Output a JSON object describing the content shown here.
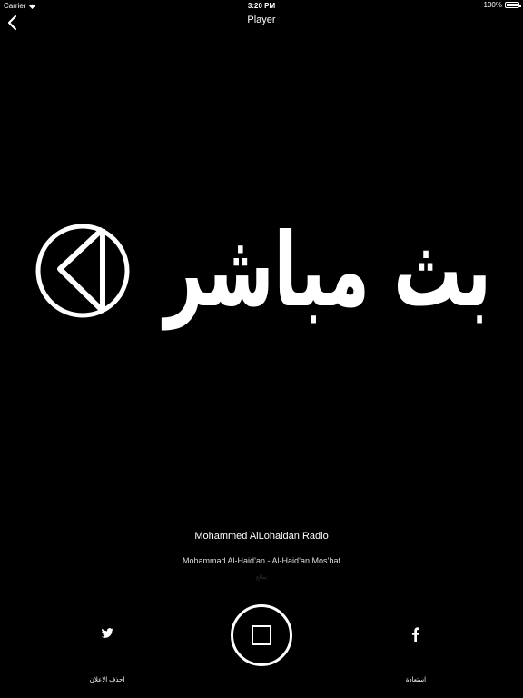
{
  "status_bar": {
    "carrier": "Carrier",
    "time": "3:20 PM",
    "battery": "100%"
  },
  "nav": {
    "title": "Player",
    "back_icon": "chevron-left-icon"
  },
  "artwork": {
    "text": "بث مباشر",
    "icon": "live-play-icon"
  },
  "now_playing": {
    "station": "Mohammed AlLohaidan Radio",
    "track": "Mohammad Al-Haid’an - Al-Haid’an Mos’haf",
    "status": "تمالح"
  },
  "controls": {
    "stop_icon": "stop-icon",
    "twitter_icon": "twitter-icon",
    "facebook_icon": "facebook-icon",
    "remove_ads_label": "احذف الاعلان",
    "restore_label": "استعادة"
  }
}
